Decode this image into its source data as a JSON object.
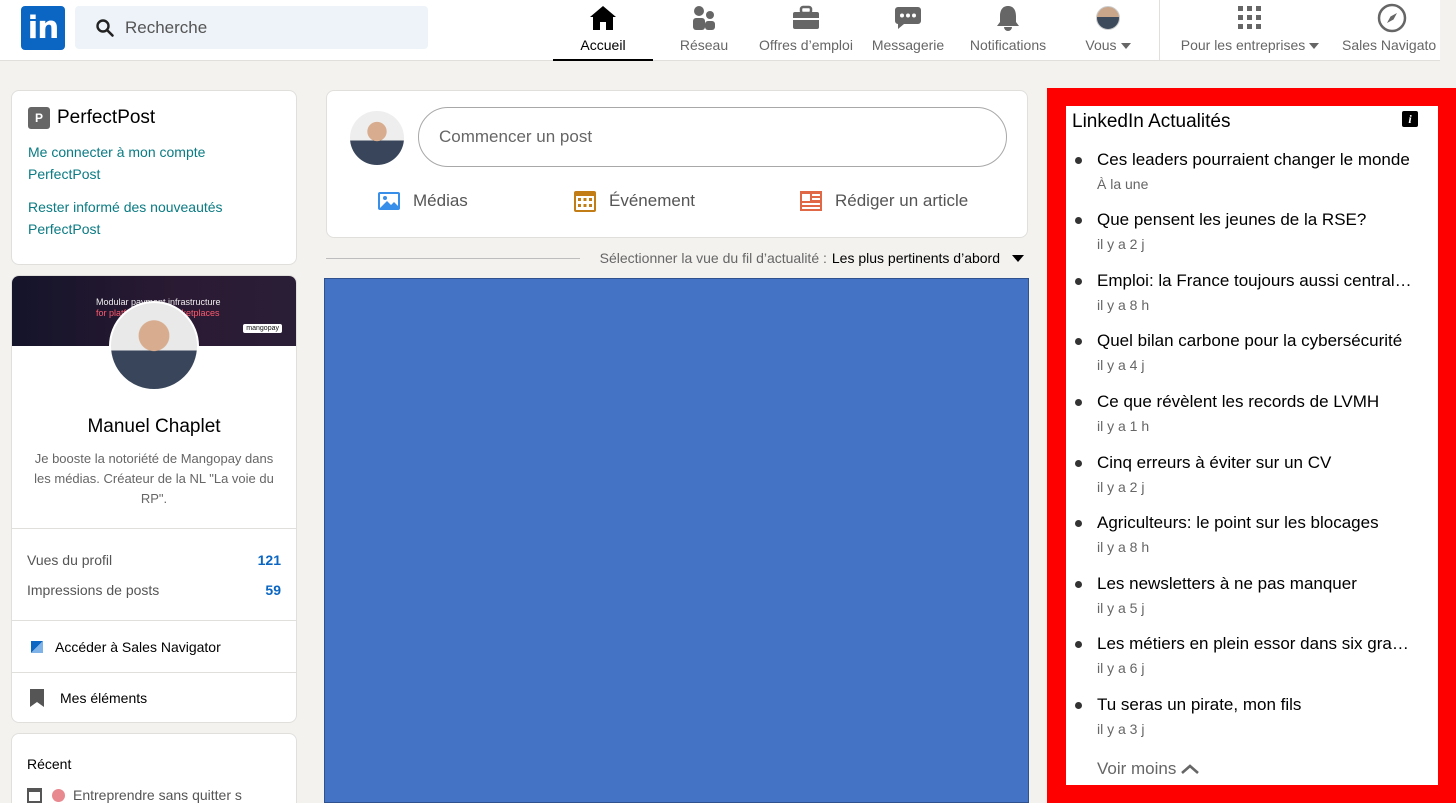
{
  "nav": {
    "search_placeholder": "Recherche",
    "items": [
      {
        "label": "Accueil"
      },
      {
        "label": "Réseau"
      },
      {
        "label": "Offres d’emploi"
      },
      {
        "label": "Messagerie"
      },
      {
        "label": "Notifications"
      },
      {
        "label": "Vous"
      },
      {
        "label": "Pour les entreprises"
      },
      {
        "label": "Sales Navigato"
      }
    ]
  },
  "perfectpost": {
    "title": "PerfectPost",
    "link1": "Me connecter à mon compte PerfectPost",
    "link2": "Rester informé des nouveautés PerfectPost"
  },
  "profile": {
    "banner_line1": "Modular payment infrastructure",
    "banner_line2": "for platforms and marketplaces",
    "banner_tag": "mangopay",
    "name": "Manuel Chaplet",
    "headline": "Je booste la notoriété de Mangopay dans les médias. Créateur de la NL \"La voie du RP\".",
    "stats": [
      {
        "label": "Vues du profil",
        "value": "121"
      },
      {
        "label": "Impressions de posts",
        "value": "59"
      }
    ],
    "sales_nav": "Accéder à Sales Navigator",
    "my_items": "Mes éléments"
  },
  "recent": {
    "title": "Récent",
    "item1": "Entreprendre sans quitter s"
  },
  "share": {
    "placeholder": "Commencer un post",
    "media": "Médias",
    "event": "Événement",
    "article": "Rédiger un article"
  },
  "feed_sort": {
    "label": "Sélectionner la vue du fil d’actualité :",
    "value": "Les plus pertinents d’abord"
  },
  "news": {
    "title": "LinkedIn Actualités",
    "items": [
      {
        "headline": "Ces leaders pourraient changer le monde",
        "time": "À la une"
      },
      {
        "headline": "Que pensent les jeunes de la RSE?",
        "time": "il y a 2 j"
      },
      {
        "headline": "Emploi: la France toujours aussi centralisée",
        "time": "il y a 8 h"
      },
      {
        "headline": "Quel bilan carbone pour la cybersécurité",
        "time": "il y a 4 j"
      },
      {
        "headline": "Ce que révèlent les records de LVMH",
        "time": "il y a 1 h"
      },
      {
        "headline": "Cinq erreurs à éviter sur un CV",
        "time": "il y a 2 j"
      },
      {
        "headline": "Agriculteurs: le point sur les blocages",
        "time": "il y a 8 h"
      },
      {
        "headline": "Les newsletters à ne pas manquer",
        "time": "il y a 5 j"
      },
      {
        "headline": "Les métiers en plein essor dans six grandes villes",
        "time": "il y a 6 j"
      },
      {
        "headline": "Tu seras un pirate, mon fils",
        "time": "il y a 3 j"
      }
    ],
    "see_less": "Voir moins"
  },
  "colors": {
    "brand": "#0a66c2",
    "highlight_frame": "#ff0000",
    "placeholder_block": "#4472c4"
  }
}
